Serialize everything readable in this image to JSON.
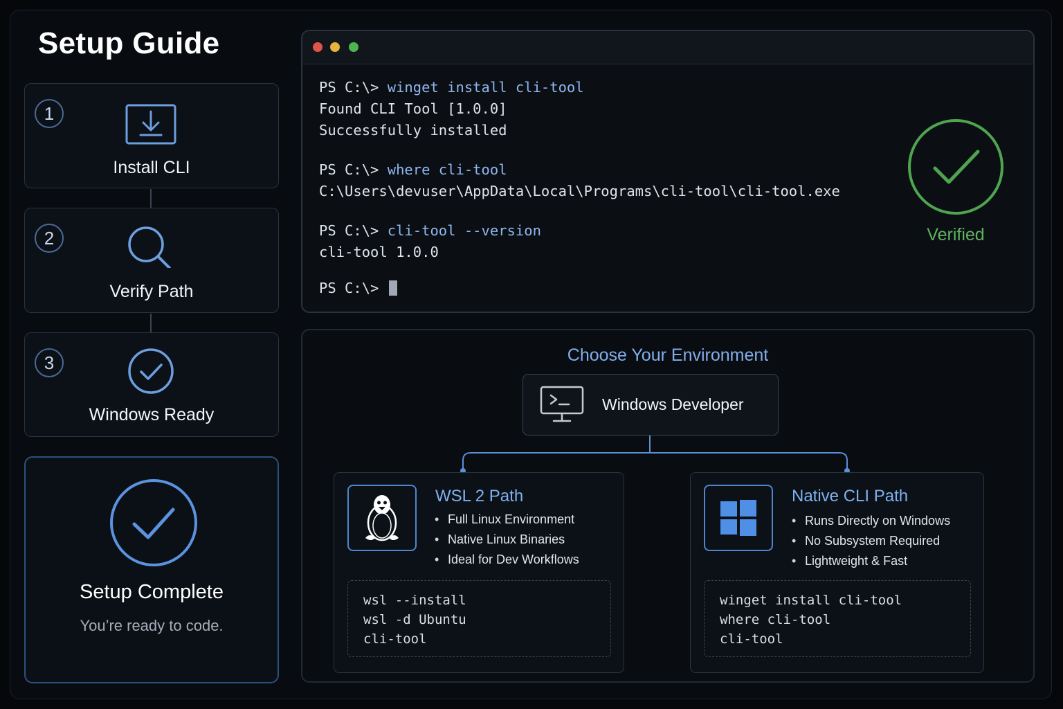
{
  "app": {
    "title": "Setup Guide"
  },
  "steps": [
    {
      "number": "1",
      "label": "Install CLI",
      "icon": "download-icon"
    },
    {
      "number": "2",
      "label": "Verify Path",
      "icon": "search-icon"
    },
    {
      "number": "3",
      "label": "Windows Ready",
      "icon": "check-circle-icon"
    }
  ],
  "complete": {
    "title": "Setup Complete",
    "subtitle": "You’re ready to code.",
    "icon": "check-circle-icon"
  },
  "terminal": {
    "lines": [
      {
        "prompt": "PS C:\\> ",
        "cmd": "winget install cli-tool"
      },
      {
        "text": "Found CLI Tool [1.0.0]"
      },
      {
        "text": "Successfully installed"
      },
      {
        "prompt": "PS C:\\> ",
        "cmd": "where cli-tool"
      },
      {
        "text": "C:\\Users\\devuser\\AppData\\Local\\Programs\\cli-tool\\cli-tool.exe"
      },
      {
        "prompt": "PS C:\\> ",
        "cmd": "cli-tool --version"
      },
      {
        "text": "cli-tool 1.0.0"
      },
      {
        "prompt": "PS C:\\> "
      }
    ],
    "status": "Verified"
  },
  "environment": {
    "title": "Choose Your Environment",
    "root": {
      "label": "Windows Developer",
      "icon": "terminal-monitor-icon"
    },
    "wsl": {
      "title": "WSL 2 Path",
      "icon": "linux-penguin-icon",
      "bullets": [
        "Full Linux Environment",
        "Native Linux Binaries",
        "Ideal for Dev Workflows"
      ],
      "code": [
        "wsl --install",
        "wsl -d Ubuntu",
        "cli-tool"
      ]
    },
    "native": {
      "title": "Native CLI Path",
      "icon": "windows-logo-icon",
      "bullets": [
        "Runs Directly on Windows",
        "No Subsystem Required",
        "Lightweight & Fast"
      ],
      "code": [
        "winget install cli-tool",
        "where cli-tool",
        "cli-tool"
      ]
    }
  },
  "colors": {
    "accent": "#82aeea",
    "success": "#5fb35f",
    "background": "#05070a",
    "dot_red": "#e0534a",
    "dot_yellow": "#e6b33c",
    "dot_green": "#4fb34f"
  }
}
